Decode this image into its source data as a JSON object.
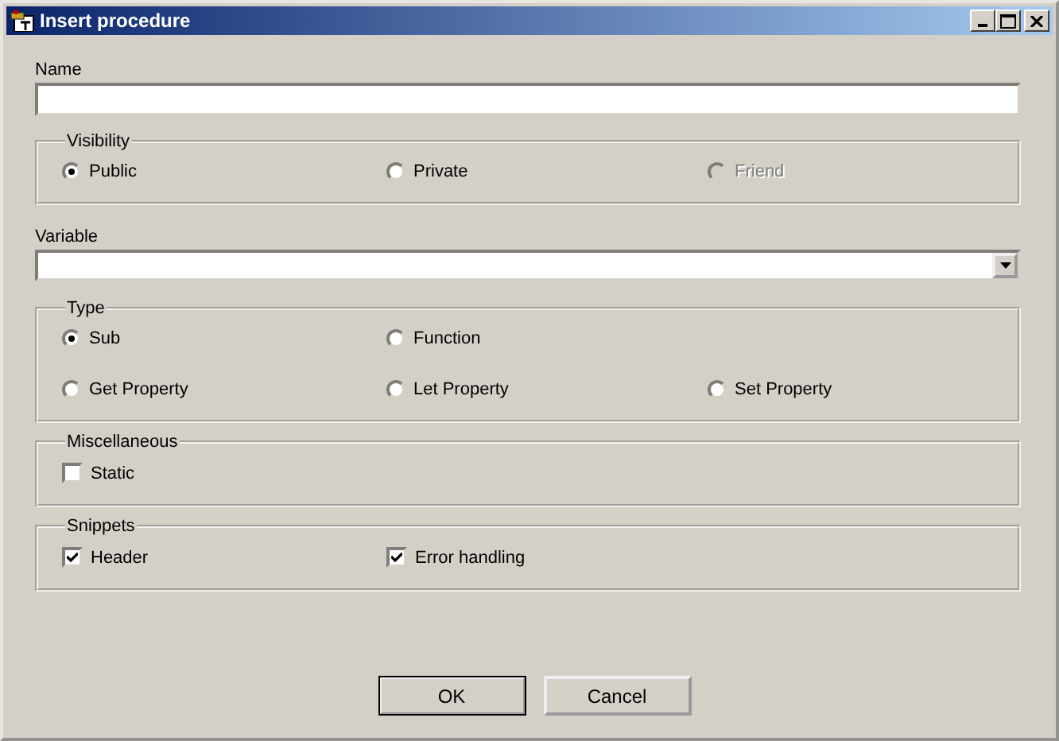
{
  "window": {
    "title": "Insert procedure"
  },
  "name": {
    "label": "Name"
  },
  "visibility": {
    "label": "Visibility",
    "options": [
      {
        "label": "Public",
        "selected": true,
        "disabled": false
      },
      {
        "label": "Private",
        "selected": false,
        "disabled": false
      },
      {
        "label": "Friend",
        "selected": false,
        "disabled": true
      }
    ]
  },
  "variable": {
    "label": "Variable"
  },
  "type": {
    "label": "Type",
    "rows": [
      [
        {
          "label": "Sub",
          "selected": true
        },
        {
          "label": "Function",
          "selected": false
        }
      ],
      [
        {
          "label": "Get Property",
          "selected": false
        },
        {
          "label": "Let Property",
          "selected": false
        },
        {
          "label": "Set Property",
          "selected": false
        }
      ]
    ]
  },
  "miscellaneous": {
    "label": "Miscellaneous",
    "options": [
      {
        "label": "Static",
        "checked": false
      }
    ]
  },
  "snippets": {
    "label": "Snippets",
    "options": [
      {
        "label": "Header",
        "checked": true
      },
      {
        "label": "Error handling",
        "checked": true
      }
    ]
  },
  "buttons": [
    {
      "label": "OK",
      "default": true
    },
    {
      "label": "Cancel",
      "default": false
    }
  ]
}
